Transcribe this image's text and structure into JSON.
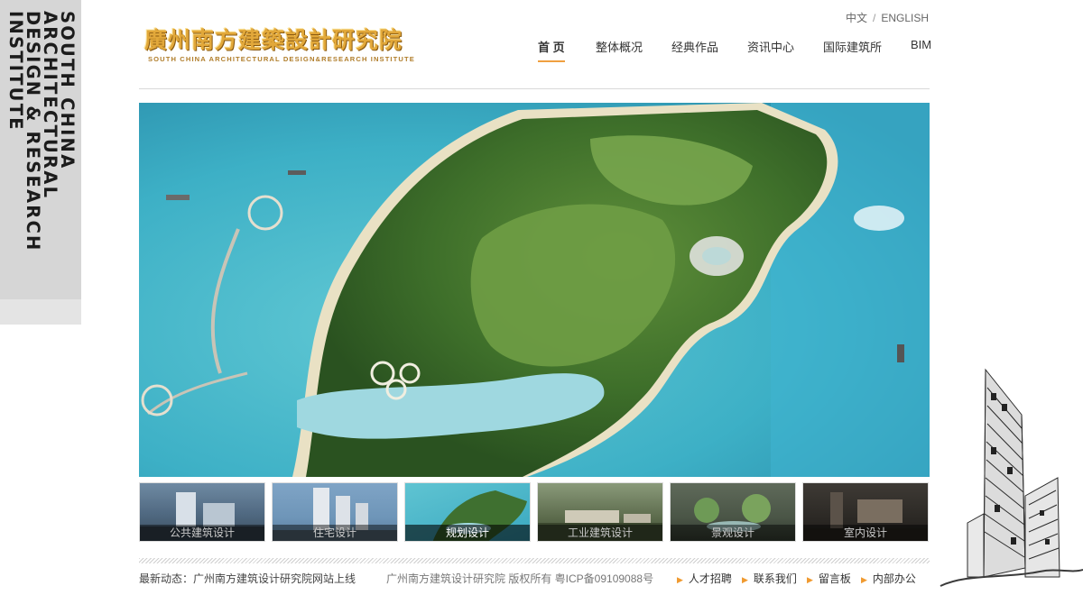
{
  "side_brand": {
    "lines": [
      "SOUTH CHINA",
      "ARCHITECTURAL",
      "DESIGN & RESEARCH",
      "INSTITUTE"
    ]
  },
  "logo": {
    "cn": "廣州南方建築設計研究院",
    "en": "SOUTH CHINA ARCHITECTURAL DESIGN&RESEARCH INSTITUTE"
  },
  "lang": {
    "zh": "中文",
    "sep": "/",
    "en": "ENGLISH"
  },
  "nav": {
    "items": [
      {
        "label": "首 页",
        "active": true
      },
      {
        "label": "整体概况",
        "active": false
      },
      {
        "label": "经典作品",
        "active": false
      },
      {
        "label": "资讯中心",
        "active": false
      },
      {
        "label": "国际建筑所",
        "active": false
      },
      {
        "label": "BIM",
        "active": false
      }
    ]
  },
  "thumbs": {
    "items": [
      {
        "label": "公共建筑设计",
        "active": false
      },
      {
        "label": "住宅设计",
        "active": false
      },
      {
        "label": "规划设计",
        "active": true
      },
      {
        "label": "工业建筑设计",
        "active": false
      },
      {
        "label": "景观设计",
        "active": false
      },
      {
        "label": "室内设计",
        "active": false
      }
    ]
  },
  "footer": {
    "news_prefix": "最新动态：",
    "news_text": "广州南方建筑设计研究院网站上线",
    "copyright": "广州南方建筑设计研究院 版权所有 粤ICP备09109088号",
    "links": [
      "人才招聘",
      "联系我们",
      "留言板",
      "内部办公"
    ]
  },
  "colors": {
    "accent": "#f0a040",
    "logo_gold": "#e2a83a",
    "sea": "#3aa6be"
  }
}
